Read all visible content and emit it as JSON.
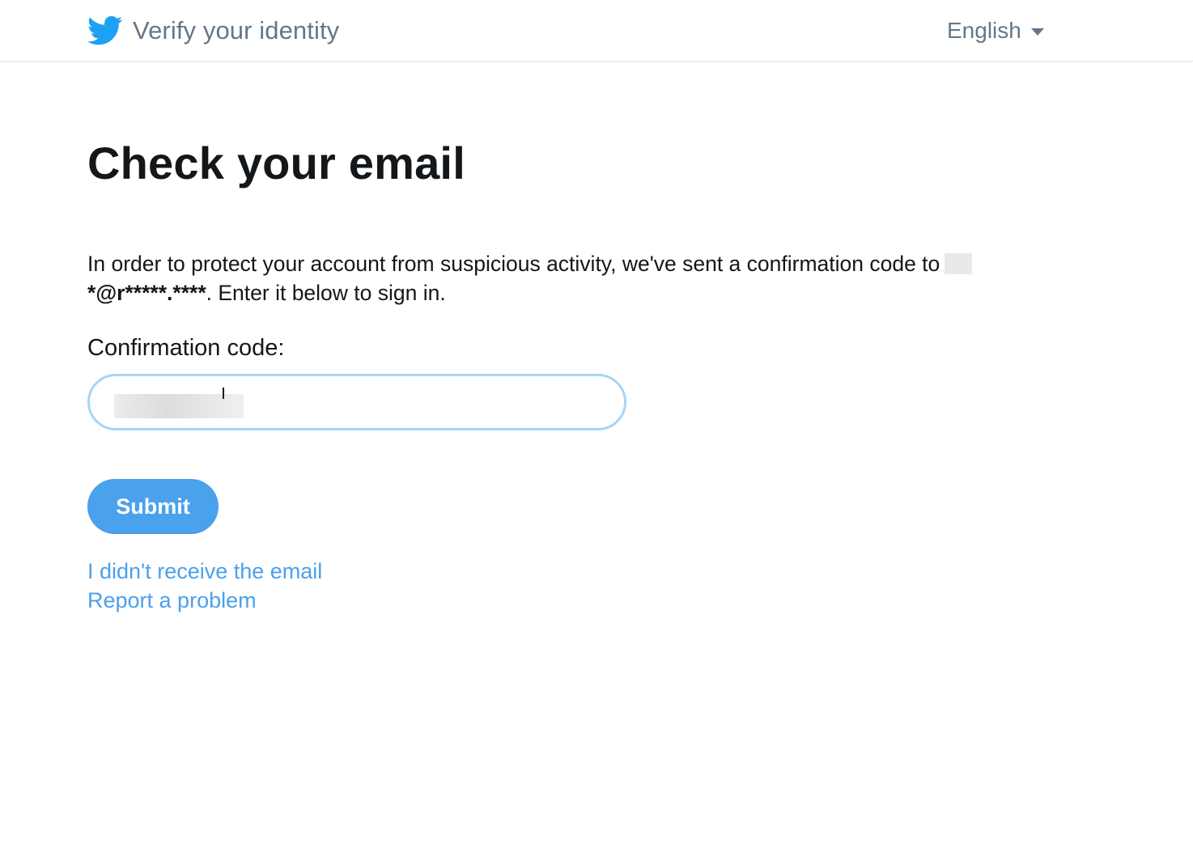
{
  "header": {
    "title": "Verify your identity",
    "language": "English",
    "brand_color": "#1da1f2",
    "icon": "twitter-bird-icon"
  },
  "main": {
    "heading": "Check your email",
    "description_prefix": "In order to protect your account from suspicious activity, we've sent a confirmation code to ",
    "masked_email": "*@r*****.****",
    "description_suffix": ". Enter it below to sign in.",
    "field_label": "Confirmation code:",
    "code_value": "",
    "submit_label": "Submit",
    "links": [
      "I didn't receive the email",
      "Report a problem"
    ],
    "accent_color": "#4aa1ec"
  }
}
